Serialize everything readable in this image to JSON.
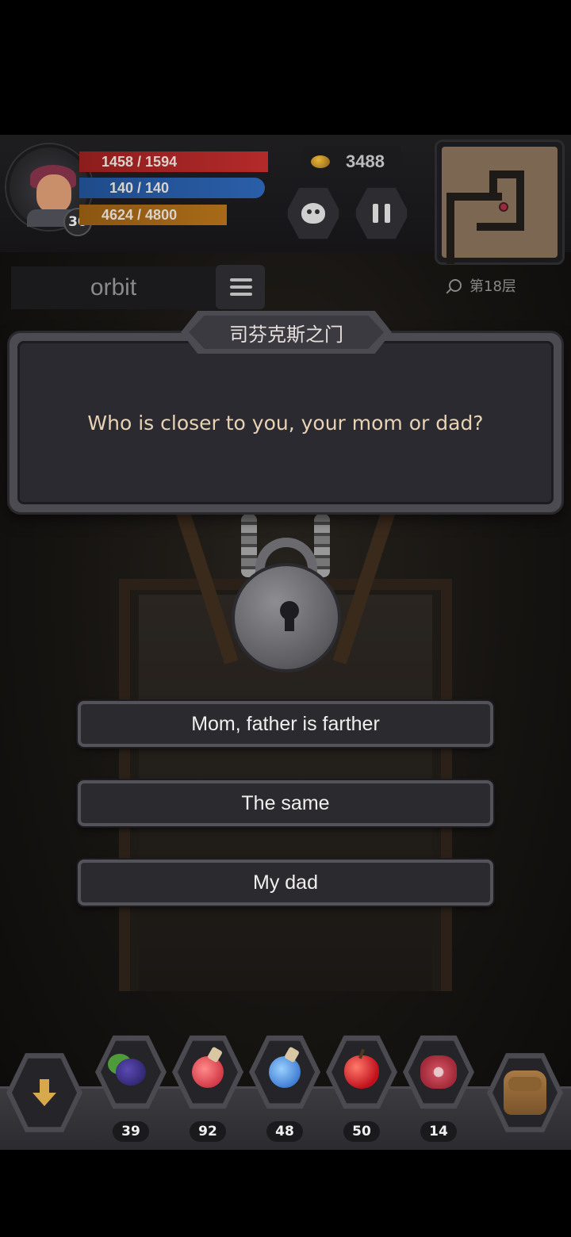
{
  "player": {
    "hp": "1458 / 1594",
    "mp": "140 / 140",
    "xp": "4624 / 4800",
    "level": "30",
    "name": "orbit"
  },
  "gold": "3488",
  "floor": "第18层",
  "dialog": {
    "title": "司芬克斯之门",
    "question": "Who is closer to you, your mom or dad?"
  },
  "answers": [
    "Mom, father is farther",
    "The same",
    "My dad"
  ],
  "inventory": [
    {
      "icon": "blackberry-icon",
      "count": "39"
    },
    {
      "icon": "red-potion-icon",
      "count": "92"
    },
    {
      "icon": "blue-potion-icon",
      "count": "48"
    },
    {
      "icon": "apple-icon",
      "count": "50"
    },
    {
      "icon": "meat-icon",
      "count": "14"
    }
  ],
  "colors": {
    "hp": "#b42a2a",
    "mp": "#2a5ea8",
    "xp": "#a86a18",
    "question_text": "#e8d3b4"
  }
}
